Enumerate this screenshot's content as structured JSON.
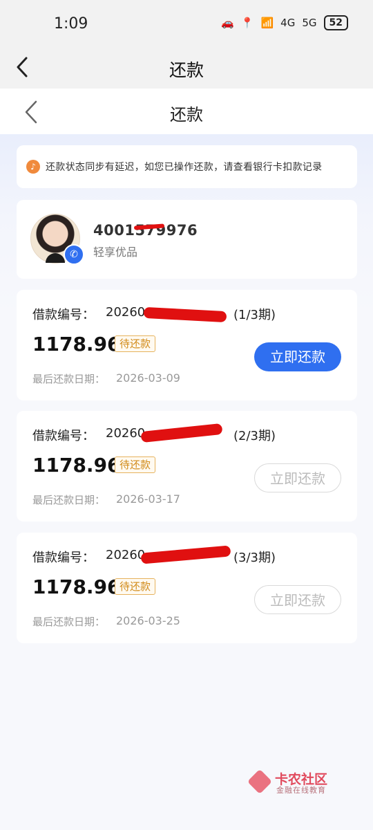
{
  "status_bar": {
    "time": "1:09",
    "signal_4g": "4G",
    "signal_5g": "5G",
    "battery": "52"
  },
  "outer_nav": {
    "title": "还款"
  },
  "inner_nav": {
    "title": "还款"
  },
  "notice": {
    "text": "还款状态同步有延迟，如您已操作还款，请查看银行卡扣款记录"
  },
  "merchant": {
    "phone": "4001579976",
    "name": "轻享优品"
  },
  "loans": [
    {
      "label": "借款编号：",
      "number": "20260",
      "period": "(1/3期)",
      "amount": "1178.96",
      "status": "待还款",
      "due_label": "最后还款日期：",
      "due_date": "2026-03-09",
      "button": "立即还款",
      "button_enabled": true
    },
    {
      "label": "借款编号：",
      "number": "20260",
      "period": "(2/3期)",
      "amount": "1178.96",
      "status": "待还款",
      "due_label": "最后还款日期：",
      "due_date": "2026-03-17",
      "button": "立即还款",
      "button_enabled": false
    },
    {
      "label": "借款编号：",
      "number": "20260",
      "period": "(3/3期)",
      "amount": "1178.96",
      "status": "待还款",
      "due_label": "最后还款日期：",
      "due_date": "2026-03-25",
      "button": "立即还款",
      "button_enabled": false
    }
  ],
  "watermark": {
    "title": "卡农社区",
    "subtitle": "金融在线教育"
  },
  "colors": {
    "accent": "#2f6ff0",
    "pending": "#d18a18",
    "redaction": "#e01010"
  }
}
